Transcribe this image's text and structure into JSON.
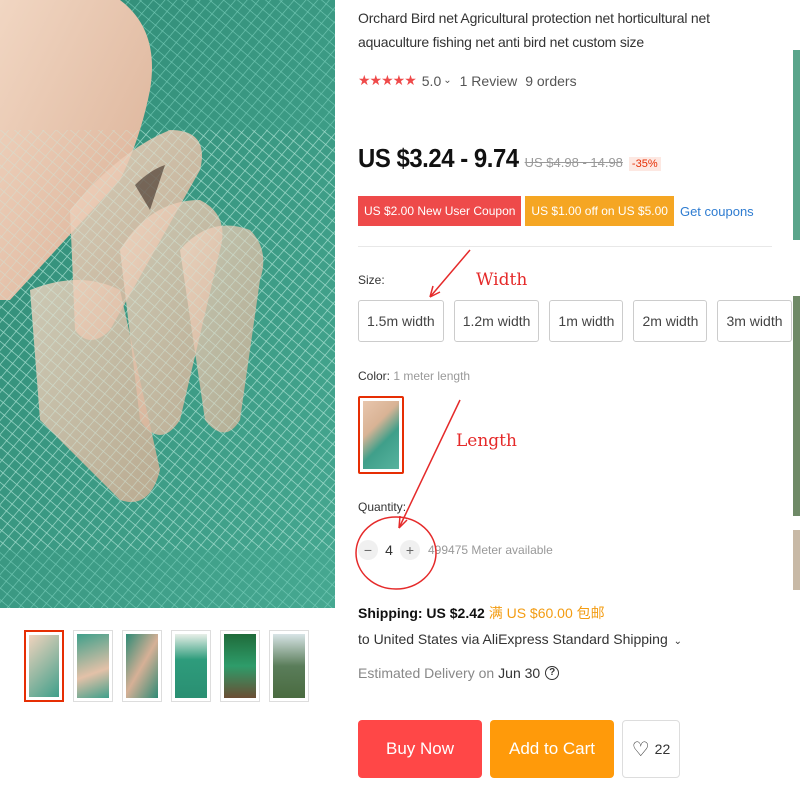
{
  "product": {
    "title": "Orchard Bird net Agricultural protection net horticultural net aquaculture fishing net anti bird net custom size",
    "rating": "5.0",
    "rating_caret": "⌄",
    "reviews": "1 Review",
    "orders": "9 orders",
    "price": "US $3.24 - 9.74",
    "old_price": "US $4.98 - 14.98",
    "discount": "-35%"
  },
  "coupons": {
    "new_user": "US $2.00 New User Coupon",
    "off": "US $1.00 off on US $5.00",
    "get_link": "Get coupons"
  },
  "size": {
    "label": "Size:",
    "options": [
      "1.5m width",
      "1.2m width",
      "1m width",
      "2m width",
      "3m width"
    ]
  },
  "color": {
    "label": "Color:",
    "value": "1 meter length"
  },
  "quantity": {
    "label": "Quantity:",
    "minus": "−",
    "value": "4",
    "plus": "+",
    "available": "499475 Meter available"
  },
  "shipping": {
    "label": "Shipping: US $2.42",
    "free_note": "满 US $60.00 包邮",
    "to": "to United States via AliExpress Standard Shipping",
    "to_caret": "⌄",
    "delivery_label": "Estimated Delivery on",
    "delivery_date": "Jun 30",
    "help": "?"
  },
  "actions": {
    "buy_now": "Buy Now",
    "add_to_cart": "Add to Cart",
    "wishlist_count": "22"
  },
  "annotations": {
    "width": "Width",
    "length": "Length"
  },
  "icons": {
    "stars": "★★★★★",
    "heart": "♡"
  },
  "colors": {
    "accent_red": "#e62e04",
    "buy": "#ff4747",
    "cart": "#ff9a0a",
    "net_green": "#3f9f8a",
    "annotation": "#e52a2a"
  }
}
